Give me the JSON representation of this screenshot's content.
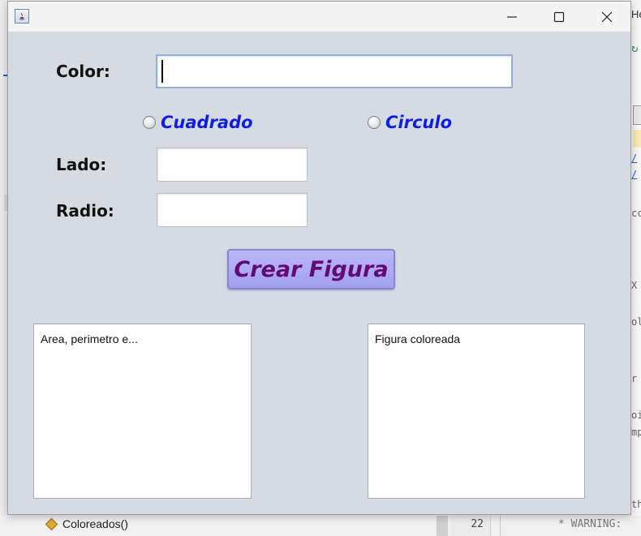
{
  "window": {
    "controls": {
      "minimize": "minimize",
      "maximize": "maximize",
      "close": "close"
    }
  },
  "form": {
    "color_label": "Color:",
    "color_value": "",
    "shape_options": [
      {
        "label": "Cuadrado",
        "selected": false
      },
      {
        "label": "Circulo",
        "selected": false
      }
    ],
    "lado_label": "Lado:",
    "lado_value": "",
    "radio_label": "Radio:",
    "radio_value": "",
    "create_button": "Crear Figura",
    "results_text": "Area, perimetro e...",
    "colored_text": "Figura coloreada"
  },
  "background_ide": {
    "right_top_fragment": "He",
    "right_fragments": [
      "cc",
      "X",
      "ol",
      "r",
      "oi",
      "mp",
      "th"
    ],
    "method_entry": "Coloreados()",
    "line_number": "22",
    "code_line": "* WARNING:"
  },
  "colors": {
    "window_bg": "#d6dae3",
    "radio_text": "#0f1fe0",
    "button_bg": "#a9a6f7",
    "button_text": "#630b73"
  }
}
